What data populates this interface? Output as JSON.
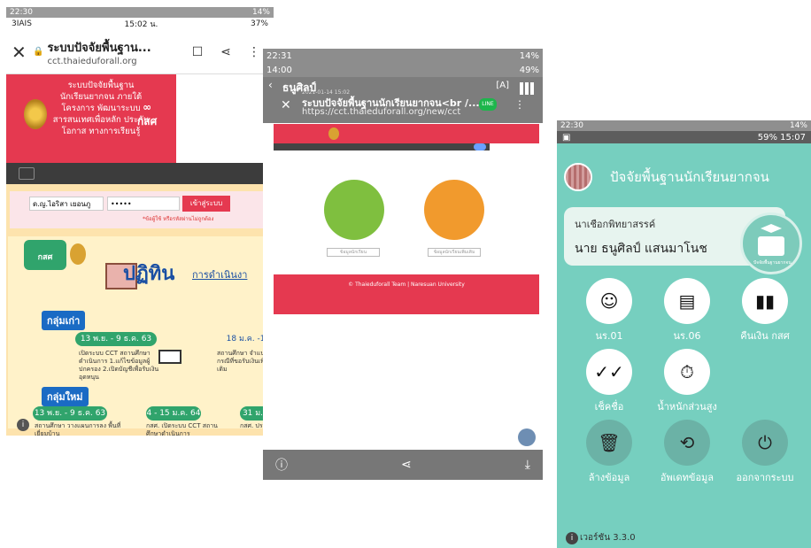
{
  "phone1": {
    "status_top": {
      "time": "22:30",
      "battery": "14%"
    },
    "status_inner": {
      "carrier": "3IAIS",
      "time": "15:02 น.",
      "battery": "37%"
    },
    "browser": {
      "title": "ระบบปัจจัยพื้นฐาน...",
      "url": "cct.thaieduforall.org"
    },
    "hero_text": "ระบบปัจจัยพื้นฐาน นักเรียนยากจน ภายใต้โครงการ พัฒนาระบบ สารสนเทศเพื่อหลัก ประกันโอกาส ทางการเรียนรู้",
    "hero_logo": "กสศ",
    "login": {
      "username": "ด.ญ.ไอริสา เยอนภู",
      "password": "•••••",
      "button": "เข้าสู่ระบบ",
      "hint": "*ข้อผู้ใช้ หรือรหัสผ่านไม่ถูกต้อง"
    },
    "banner": {
      "badge": "กสศ",
      "title": "ปฏิทิน",
      "subtitle": "การดำเนินงา",
      "group_old": "กลุ่มเก่า",
      "group_new": "กลุ่มใหม่",
      "date1": "13 พ.ย. - 9 ธ.ค. 63",
      "date2": "18 ม.ค. -18 ก.พ",
      "date3": "13 พ.ย. - 9 ธ.ค. 63",
      "date4": "4 - 15 ม.ค. 64",
      "date5": "31 ม.ค. -",
      "text1": "เปิดระบบ CCT สถานศึกษาดำเนินการ 1.แก้ไขข้อมูลผู้ปกครอง 2.เปิดบัญชีเพื่อรับเงินอุดหนุน",
      "text2": "สถานศึกษา จำแนก กรณีที่ขอรับเงินเพิ่มเติม",
      "text3": "สถานศึกษา วางแผนการลง พื้นที่เยี่ยมบ้าน",
      "text4": "กสศ. เปิดระบบ CCT สถานศึกษาดำเนินการ",
      "text5": "กสศ. ประกา"
    }
  },
  "phone2": {
    "status_top": {
      "time": "22:31",
      "battery": "14%"
    },
    "status_inner": {
      "time": "14:00",
      "battery": "49%"
    },
    "header": {
      "name": "ธนูศิลป์",
      "time": "2021-01-14 15:02",
      "title": "ระบบปัจจัยพื้นฐานนักเรียนยากจน<br /...",
      "url": "https://cct.thaieduforall.org/new/cct",
      "line_badge": "LINE"
    },
    "labels": {
      "left": "ข้อมูลนักเรียน",
      "right": "ข้อมูลนักเรียนเพิ่มเติม"
    },
    "footer_text": "© Thaieduforall Team | Naresuan University"
  },
  "phone3": {
    "status_top": {
      "time": "22:30",
      "battery": "14%"
    },
    "status_inner": {
      "battery": "59%",
      "time": "15:07"
    },
    "app_title": "ปัจจัยพื้นฐานนักเรียนยากจน",
    "profile": {
      "school": "นาเชือกพิทยาสรรค์",
      "name": "นาย ธนูศิลป์ แสนมาโนช",
      "book_caption": "ปัจจัยพื้นฐานยากจน"
    },
    "menu": [
      {
        "label": "นร.01",
        "icon": "face-icon"
      },
      {
        "label": "นร.06",
        "icon": "document-icon"
      },
      {
        "label": "คืนเงิน กสศ",
        "icon": "barcode-icon"
      },
      {
        "label": "เช็คชื่อ",
        "icon": "double-check-icon"
      },
      {
        "label": "น้ำหนักส่วนสูง",
        "icon": "stopwatch-icon"
      },
      {
        "label": "ล้างข้อมูล",
        "icon": "delete-icon"
      },
      {
        "label": "อัพเดทข้อมูล",
        "icon": "sync-icon"
      },
      {
        "label": "ออกจากระบบ",
        "icon": "power-icon"
      }
    ],
    "version": "เวอร์ชัน 3.3.0"
  },
  "colors": {
    "red": "#e53950",
    "teal": "#76cfbf",
    "green": "#30a46c",
    "blue": "#1a6bc4"
  }
}
